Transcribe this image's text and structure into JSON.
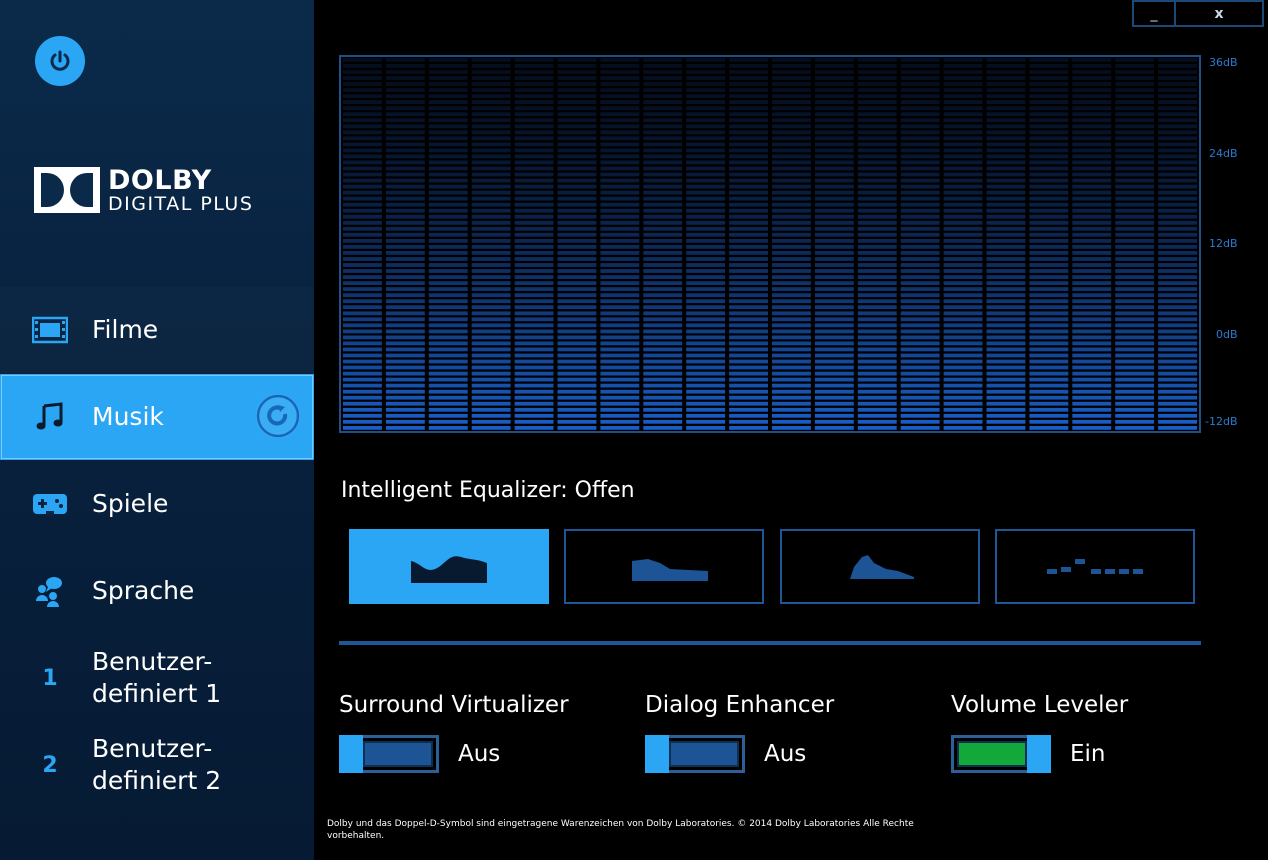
{
  "sidebar": {
    "logo": {
      "brand": "DOLBY",
      "sub": "DIGITAL PLUS"
    },
    "items": [
      {
        "label": "Filme",
        "icon": "film-icon"
      },
      {
        "label": "Musik",
        "icon": "music-note-icon",
        "active": true
      },
      {
        "label": "Spiele",
        "icon": "gamepad-icon"
      },
      {
        "label": "Sprache",
        "icon": "speech-people-icon"
      },
      {
        "label_line1": "Benutzer-",
        "label_line2": "definiert 1",
        "icon": "number-one-icon",
        "icon_text": "1"
      },
      {
        "label_line1": "Benutzer-",
        "label_line2": "definiert 2",
        "icon": "number-two-icon",
        "icon_text": "2"
      }
    ]
  },
  "window": {
    "minimize": "_",
    "close": "x"
  },
  "equalizer": {
    "db_labels": [
      "36dB",
      "24dB",
      "12dB",
      "0dB",
      "-12dB"
    ],
    "title": "Intelligent Equalizer: Offen",
    "presets": [
      "preset-open",
      "preset-rich",
      "preset-focused",
      "preset-custom"
    ],
    "selected_preset": 0
  },
  "toggles": [
    {
      "label": "Surround Virtualizer",
      "state": "Aus",
      "on": false
    },
    {
      "label": "Dialog Enhancer",
      "state": "Aus",
      "on": false
    },
    {
      "label": "Volume Leveler",
      "state": "Ein",
      "on": true
    }
  ],
  "footer": "Dolby und das Doppel-D-Symbol sind eingetragene Warenzeichen von Dolby Laboratories. © 2014 Dolby Laboratories Alle Rechte vorbehalten.",
  "colors": {
    "accent": "#2aa6f5",
    "frame": "#1f5796",
    "on_green": "#12a83a",
    "off_fill": "#1c5496"
  }
}
